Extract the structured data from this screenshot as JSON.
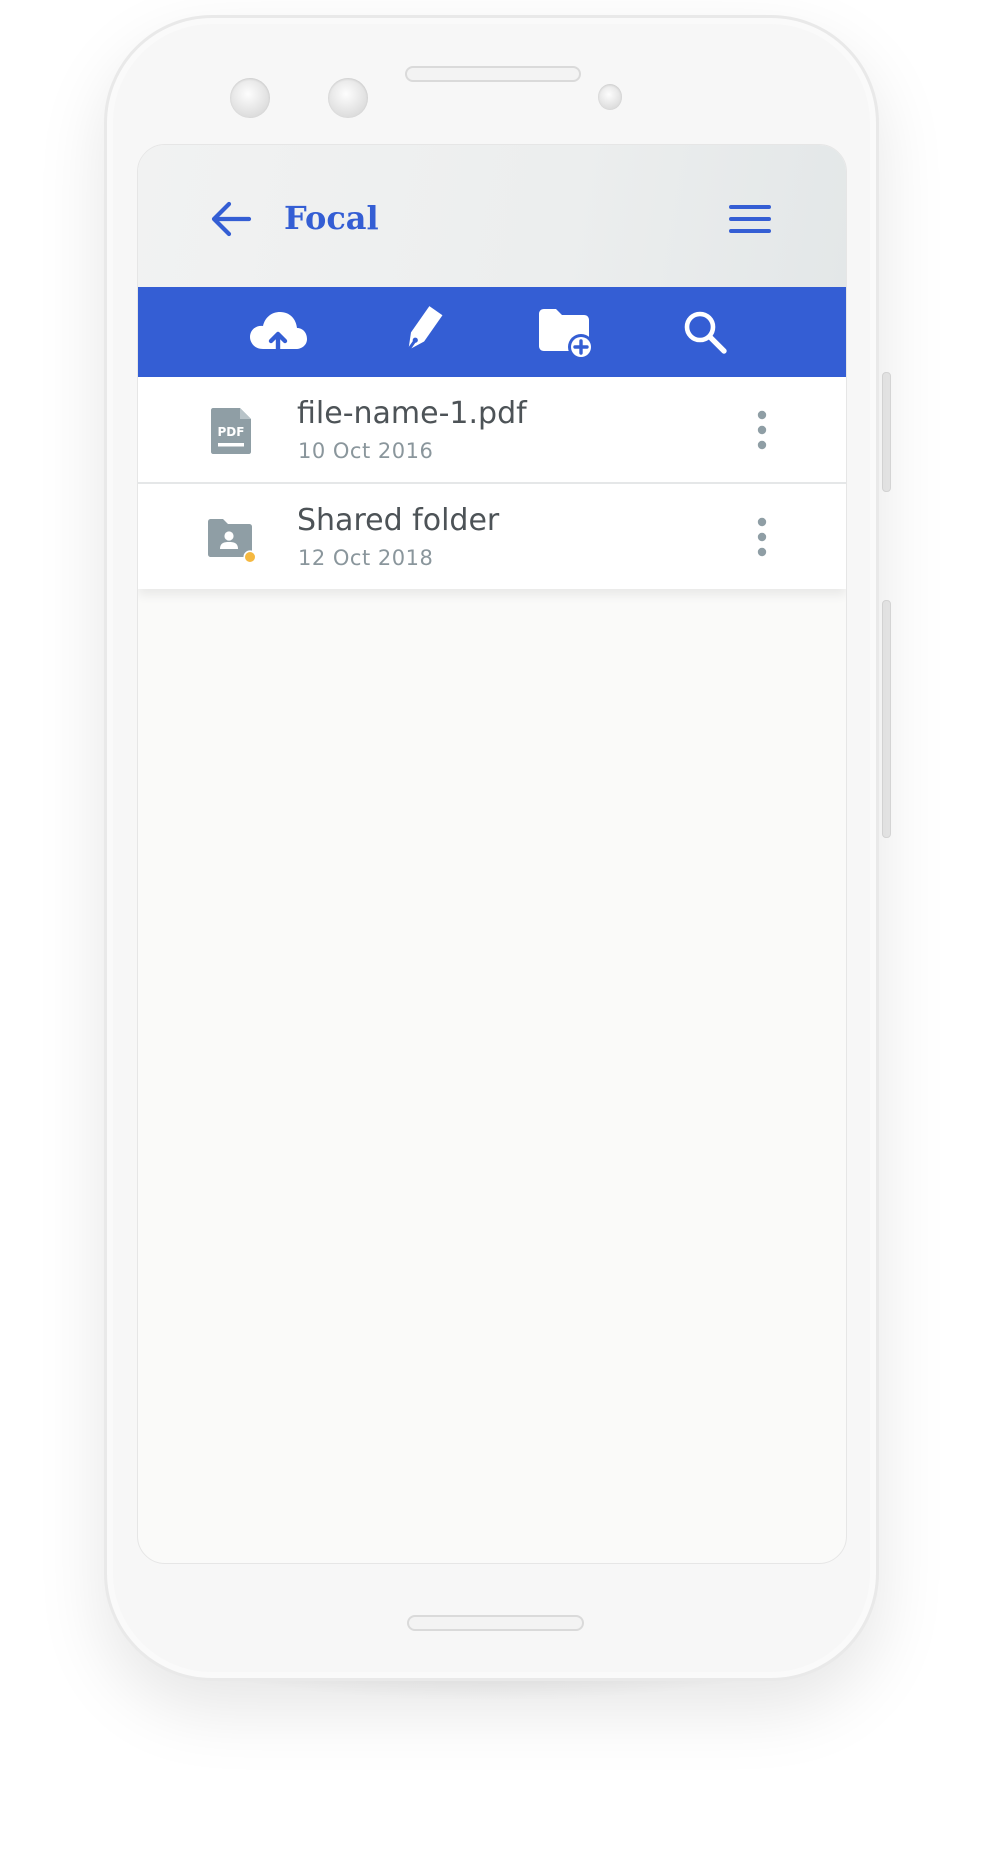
{
  "app": {
    "title": "Focal"
  },
  "header": {
    "back_icon": "arrow-left-icon",
    "menu_icon": "hamburger-menu-icon"
  },
  "toolbar": {
    "actions": [
      {
        "icon": "cloud-upload-icon"
      },
      {
        "icon": "pen-edit-icon"
      },
      {
        "icon": "folder-add-icon"
      },
      {
        "icon": "search-icon"
      }
    ]
  },
  "files": [
    {
      "name": "file-name-1.pdf",
      "date": "10 Oct 2016",
      "icon": "pdf-file-icon",
      "icon_text": "PDF"
    },
    {
      "name": "Shared folder",
      "date": "12 Oct 2018",
      "icon": "shared-folder-icon"
    }
  ],
  "colors": {
    "accent": "#345ed4",
    "icon_gray": "#8f9ea5",
    "shared_badge": "#f5b840",
    "text_primary": "#4d5357",
    "text_secondary": "#8a969c"
  }
}
